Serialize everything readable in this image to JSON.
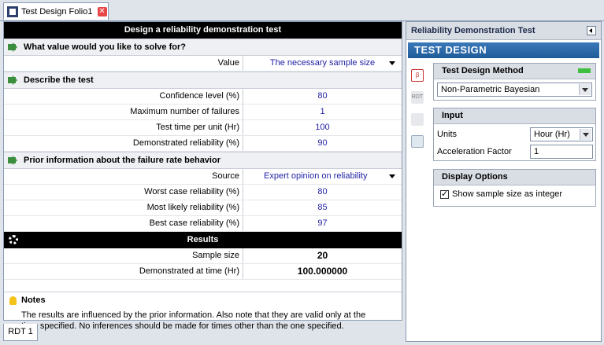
{
  "tab": {
    "title": "Test Design Folio1"
  },
  "form": {
    "title": "Design a reliability demonstration test",
    "solve_for": {
      "heading": "What value would you like to solve for?",
      "label": "Value",
      "value": "The necessary sample size"
    },
    "describe": {
      "heading": "Describe the test",
      "rows": [
        {
          "label": "Confidence level (%)",
          "value": "80"
        },
        {
          "label": "Maximum number of failures",
          "value": "1"
        },
        {
          "label": "Test time per unit (Hr)",
          "value": "100"
        },
        {
          "label": "Demonstrated reliability (%)",
          "value": "90"
        }
      ]
    },
    "prior": {
      "heading": "Prior information about the failure rate behavior",
      "source_label": "Source",
      "source_value": "Expert opinion on reliability",
      "rows": [
        {
          "label": "Worst case reliability (%)",
          "value": "80"
        },
        {
          "label": "Most likely reliability (%)",
          "value": "85"
        },
        {
          "label": "Best case reliability (%)",
          "value": "97"
        }
      ]
    },
    "results": {
      "heading": "Results",
      "rows": [
        {
          "label": "Sample size",
          "value": "20"
        },
        {
          "label": "Demonstrated at time (Hr)",
          "value": "100.000000"
        }
      ]
    },
    "notes": {
      "heading": "Notes",
      "line1": "The results are influenced by the prior information. Also note that they are valid only at the",
      "line2": "time specified. No inferences should be made for times other than the one specified."
    }
  },
  "bottom_tab": {
    "label": "RDT 1"
  },
  "right_panel": {
    "title": "Reliability Demonstration Test",
    "banner": "TEST DESIGN",
    "tool_rdt_label": "RDT",
    "method": {
      "heading": "Test Design Method",
      "selected": "Non-Parametric Bayesian"
    },
    "input": {
      "heading": "Input",
      "units_label": "Units",
      "units_value": "Hour (Hr)",
      "accel_label": "Acceleration Factor",
      "accel_value": "1"
    },
    "display": {
      "heading": "Display Options",
      "checkbox_label": "Show sample size as integer",
      "checked": true
    }
  }
}
